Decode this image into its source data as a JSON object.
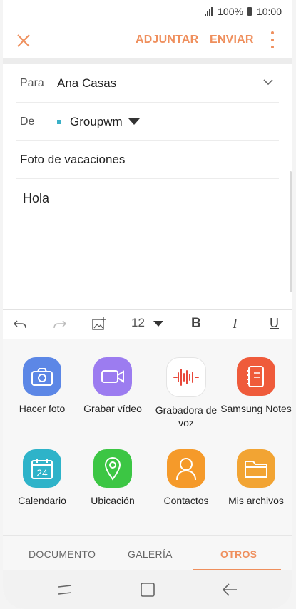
{
  "status": {
    "battery": "100%",
    "time": "10:00"
  },
  "appbar": {
    "attach": "ADJUNTAR",
    "send": "ENVIAR"
  },
  "compose": {
    "to_label": "Para",
    "to_value": "Ana Casas",
    "from_label": "De",
    "from_value": "Groupwm",
    "subject": "Foto de vacaciones",
    "body": "Hola"
  },
  "toolbar": {
    "font_size": "12",
    "bold": "B",
    "italic": "I",
    "underline": "U"
  },
  "apps": [
    {
      "label": "Hacer foto",
      "icon": "camera-icon",
      "color": "#5c87e6"
    },
    {
      "label": "Grabar vídeo",
      "icon": "video-camera-icon",
      "color": "#9c7cf0"
    },
    {
      "label": "Grabadora de voz",
      "icon": "voice-recorder-icon",
      "color": "#ffffff"
    },
    {
      "label": "Samsung Notes",
      "icon": "notes-icon",
      "color": "#ef5b3b"
    },
    {
      "label": "Calendario",
      "icon": "calendar-icon",
      "color": "#2eb3c9",
      "calendar_day": "24"
    },
    {
      "label": "Ubicación",
      "icon": "location-pin-icon",
      "color": "#3cc644"
    },
    {
      "label": "Contactos",
      "icon": "contacts-icon",
      "color": "#f59a2a"
    },
    {
      "label": "Mis archivos",
      "icon": "folder-icon",
      "color": "#f2a433"
    }
  ],
  "tabs": [
    "DOCUMENTO",
    "GALERÍA",
    "OTROS"
  ],
  "active_tab": "OTROS",
  "colors": {
    "accent": "#ef8f5d"
  }
}
